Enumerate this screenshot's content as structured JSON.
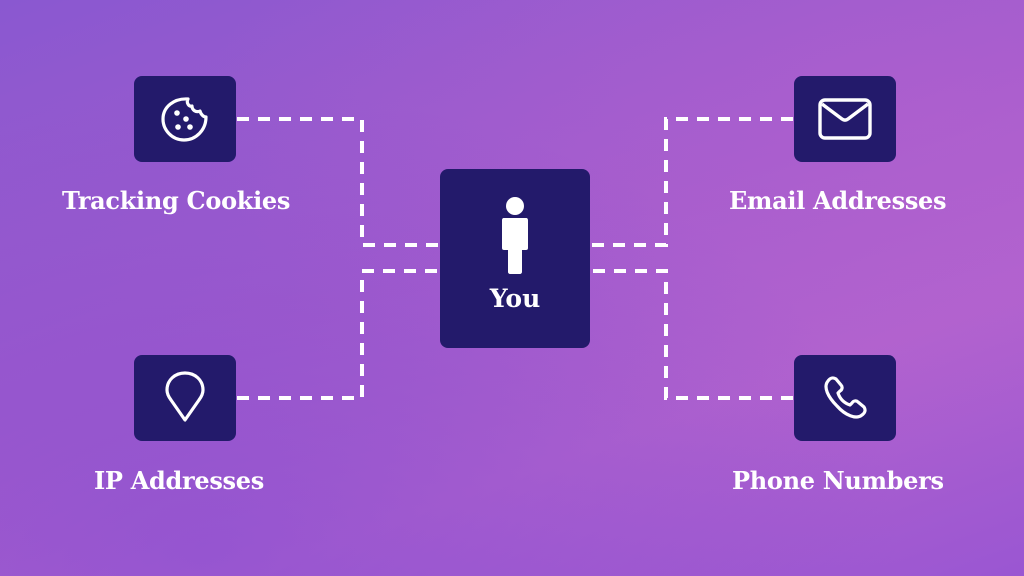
{
  "diagram": {
    "center": {
      "label": "You",
      "icon": "person-icon"
    },
    "nodes": [
      {
        "id": "tracking-cookies",
        "label": "Tracking Cookies",
        "icon": "cookie-icon"
      },
      {
        "id": "ip-addresses",
        "label": "IP Addresses",
        "icon": "location-pin-icon"
      },
      {
        "id": "email-addresses",
        "label": "Email Addresses",
        "icon": "envelope-icon"
      },
      {
        "id": "phone-numbers",
        "label": "Phone Numbers",
        "icon": "phone-icon"
      }
    ],
    "connections": [
      {
        "from": "tracking-cookies",
        "to": "center",
        "style": "dashed"
      },
      {
        "from": "ip-addresses",
        "to": "center",
        "style": "dashed"
      },
      {
        "from": "email-addresses",
        "to": "center",
        "style": "dashed"
      },
      {
        "from": "phone-numbers",
        "to": "center",
        "style": "dashed"
      }
    ],
    "colors": {
      "node_fill": "#231a6b",
      "foreground": "#ffffff",
      "background_start": "#8a58d0",
      "background_end": "#b062ce"
    }
  }
}
